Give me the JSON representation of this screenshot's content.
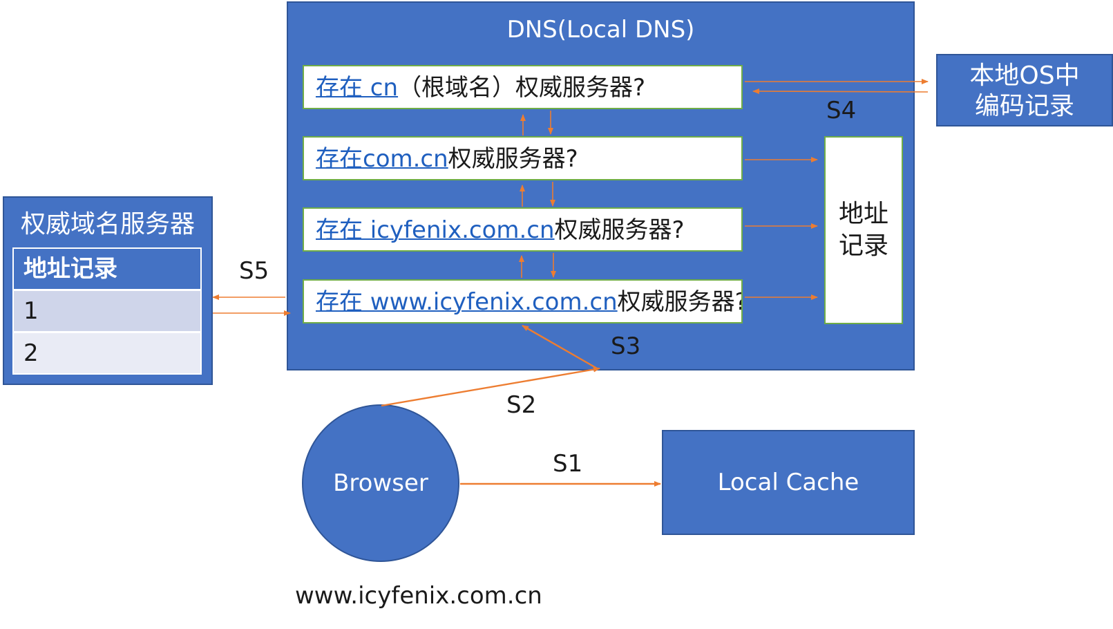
{
  "dns": {
    "title": "DNS(Local DNS)",
    "questions": [
      {
        "link": "存在 cn",
        "text": "（根域名）权威服务器?"
      },
      {
        "link": "存在com.cn",
        "text": "权威服务器?"
      },
      {
        "link": "存在 icyfenix.com.cn",
        "text": "权威服务器?"
      },
      {
        "link": "存在 www.icyfenix.com.cn",
        "text": "权威服务器?"
      }
    ],
    "address_record": {
      "line1": "地址",
      "line2": "记录"
    }
  },
  "os_record": {
    "line1": "本地OS中",
    "line2": "编码记录"
  },
  "authoritative": {
    "title": "权威域名服务器",
    "table_header": "地址记录",
    "rows": [
      "1",
      "2"
    ]
  },
  "browser": {
    "label": "Browser"
  },
  "local_cache": {
    "label": "Local Cache"
  },
  "steps": {
    "s1": "S1",
    "s2": "S2",
    "s3": "S3",
    "s4": "S4",
    "s5": "S5"
  },
  "domain": "www.icyfenix.com.cn",
  "colors": {
    "box_fill": "#4472c4",
    "arrow": "#ed7d31",
    "row_border": "#70ad47",
    "link": "#1f5fbf"
  }
}
